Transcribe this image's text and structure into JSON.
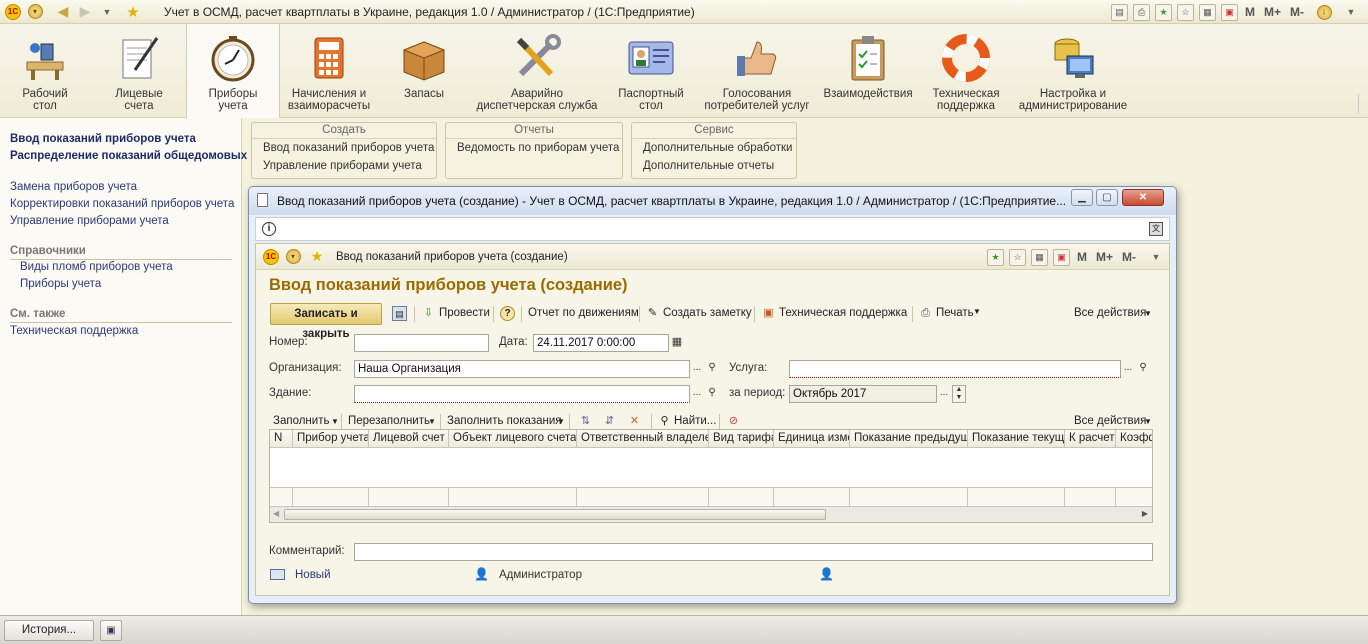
{
  "app": {
    "title": "Учет в ОСМД, расчет квартплаты в Украине, редакция 1.0 / Администратор /   (1С:Предприятие)",
    "m_labels": [
      "M",
      "M+",
      "M-"
    ]
  },
  "sections": [
    {
      "label": "Рабочий\nстол",
      "icon": "desk-icon"
    },
    {
      "label": "Лицевые\nсчета",
      "icon": "notepad-pen-icon"
    },
    {
      "label": "Приборы\nучета",
      "icon": "gauge-icon",
      "active": true
    },
    {
      "label": "Начисления и\nвзаиморасчеты",
      "icon": "calculator-icon"
    },
    {
      "label": "Запасы",
      "icon": "box-icon"
    },
    {
      "label": "Аварийно\nдиспетчерская служба",
      "icon": "tools-icon"
    },
    {
      "label": "Паспортный\nстол",
      "icon": "id-card-icon"
    },
    {
      "label": "Голосования\nпотребителей услуг",
      "icon": "thumbs-up-icon"
    },
    {
      "label": "Взаимодействия",
      "icon": "clipboard-icon"
    },
    {
      "label": "Техническая\nподдержка",
      "icon": "lifebuoy-icon"
    },
    {
      "label": "Настройка и\nадминистрирование",
      "icon": "admin-pc-icon"
    }
  ],
  "leftnav": {
    "bold_items": [
      "Ввод показаний приборов учета",
      "Распределение показаний общедомовых ..."
    ],
    "items": [
      "Замена приборов учета",
      "Корректировки показаний приборов учета",
      "Управление приборами учета"
    ],
    "refs_header": "Справочники",
    "refs": [
      "Виды пломб приборов учета",
      "Приборы учета"
    ],
    "see_also_header": "См. также",
    "see_also": [
      "Техническая поддержка"
    ]
  },
  "command_groups": {
    "create": {
      "title": "Создать",
      "items": [
        "Ввод показаний приборов учета",
        "Управление приборами учета"
      ]
    },
    "reports": {
      "title": "Отчеты",
      "items": [
        "Ведомость по приборам учета"
      ]
    },
    "service": {
      "title": "Сервис",
      "items": [
        "Дополнительные обработки",
        "Дополнительные отчеты"
      ]
    }
  },
  "window": {
    "title": "Ввод показаний приборов учета (создание) - Учет в ОСМД, расчет квартплаты в Украине, редакция 1.0 / Администратор / (1С:Предприятие...",
    "inner_title": "Ввод показаний приборов учета (создание)",
    "form_title": "Ввод показаний приборов учета (создание)"
  },
  "toolbar": {
    "save_close": "Записать и закрыть",
    "post": "Провести",
    "movements_report": "Отчет по движениям",
    "create_note": "Создать заметку",
    "tech_support": "Техническая поддержка",
    "print": "Печать",
    "all_actions": "Все действия"
  },
  "fields": {
    "number_label": "Номер:",
    "number_value": "",
    "date_label": "Дата:",
    "date_value": "24.11.2017  0:00:00",
    "org_label": "Организация:",
    "org_value": "Наша Организация",
    "service_label": "Услуга:",
    "service_value": "",
    "building_label": "Здание:",
    "building_value": "",
    "period_label": "за период:",
    "period_value": "Октябрь 2017",
    "comment_label": "Комментарий:",
    "comment_value": ""
  },
  "table_toolbar": {
    "fill": "Заполнить",
    "refill": "Перезаполнить",
    "fill_readings": "Заполнить показания",
    "find": "Найти...",
    "all_actions": "Все действия"
  },
  "table": {
    "columns": [
      "N",
      "Прибор учета",
      "Лицевой счет",
      "Объект лицевого счета",
      "Ответственный владелец",
      "Вид тарифа",
      "Единица измерения",
      "Показание предыдущее",
      "Показание текущее",
      "К расчету",
      "Коэффициент"
    ]
  },
  "footer": {
    "status": "Новый",
    "author": "Администратор"
  },
  "taskbar": {
    "history": "История..."
  }
}
